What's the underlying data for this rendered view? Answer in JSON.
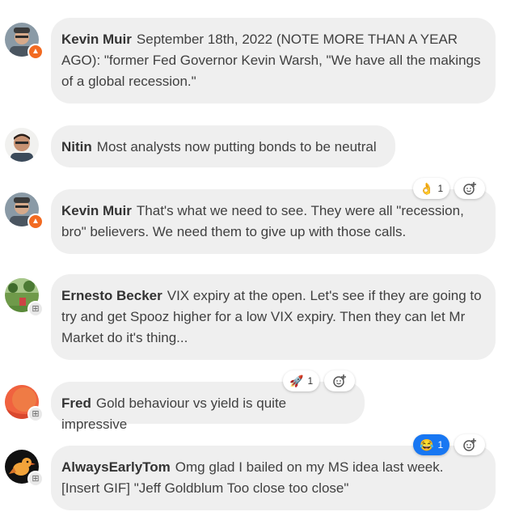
{
  "colors": {
    "bubble": "#efefef",
    "admin_badge": "#f26a21",
    "active_reaction": "#1877f2"
  },
  "messages": [
    {
      "author": "Kevin Muir",
      "text": "September 18th, 2022 (NOTE MORE THAN A YEAR AGO): \"former Fed Governor Kevin Warsh, \"We have all the makings of a global recession.\"",
      "badge": "fire-icon"
    },
    {
      "author": "Nitin",
      "text": "Most analysts now putting bonds to be neutral"
    },
    {
      "author": "Kevin Muir",
      "text": "That's what we need to see. They were all \"recession, bro\" believers. We need them to give up with those calls.",
      "badge": "fire-icon",
      "reaction": {
        "emoji": "👌",
        "count": "1"
      }
    },
    {
      "author": "Ernesto Becker",
      "text": "VIX expiry at the open. Let's see if they are going to try and get Spooz higher for a low VIX expiry. Then they can let Mr Market do it's thing...",
      "badge": "member-icon"
    },
    {
      "author": "Fred",
      "text": "Gold behaviour vs yield is quite impressive",
      "badge": "member-icon",
      "reaction": {
        "emoji": "🚀",
        "count": "1"
      }
    },
    {
      "author": "AlwaysEarlyTom",
      "text": "Omg glad I bailed on my MS idea last week. [Insert GIF] \"Jeff Goldblum Too close too close\"",
      "badge": "member-icon",
      "reaction": {
        "emoji": "😂",
        "count": "1"
      }
    }
  ]
}
